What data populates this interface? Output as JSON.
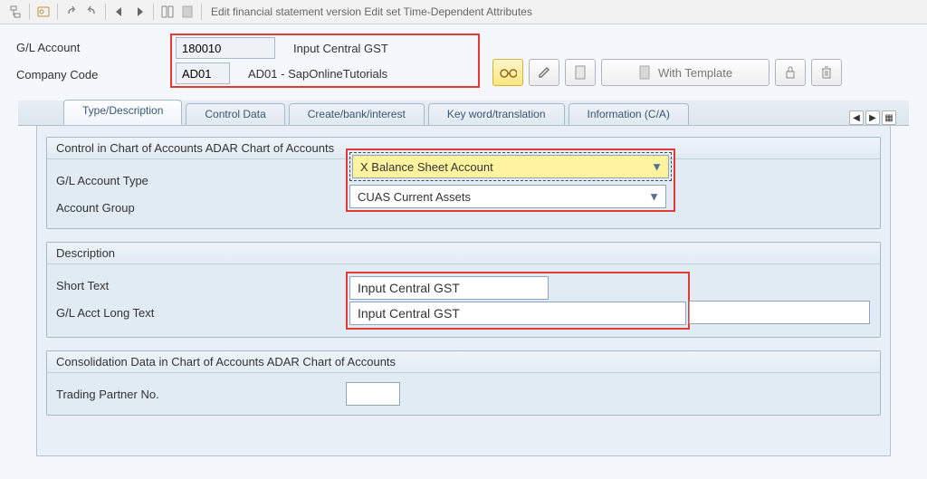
{
  "toolbar": {
    "title": "Edit financial statement version Edit set Time-Dependent Attributes"
  },
  "header": {
    "gl_account_label": "G/L Account",
    "gl_account_value": "180010",
    "gl_account_desc": "Input Central GST",
    "company_code_label": "Company Code",
    "company_code_value": "AD01",
    "company_code_desc": "AD01 - SapOnlineTutorials",
    "with_template_label": "With Template"
  },
  "tabs": {
    "t1": "Type/Description",
    "t2": "Control Data",
    "t3": "Create/bank/interest",
    "t4": "Key word/translation",
    "t5": "Information (C/A)"
  },
  "panelControl": {
    "title": "Control in Chart of Accounts ADAR Chart of Accounts",
    "gl_type_label": "G/L Account Type",
    "gl_type_value": "X  Balance Sheet Account",
    "account_group_label": "Account Group",
    "account_group_value": "CUAS  Current Assets"
  },
  "panelDesc": {
    "title": "Description",
    "short_text_label": "Short Text",
    "short_text_value": "Input Central GST",
    "long_text_label": "G/L Acct Long Text",
    "long_text_value": "Input Central GST"
  },
  "panelConsolidation": {
    "title": "Consolidation Data in Chart of Accounts ADAR Chart of Accounts",
    "trading_partner_label": "Trading Partner No.",
    "trading_partner_value": ""
  }
}
